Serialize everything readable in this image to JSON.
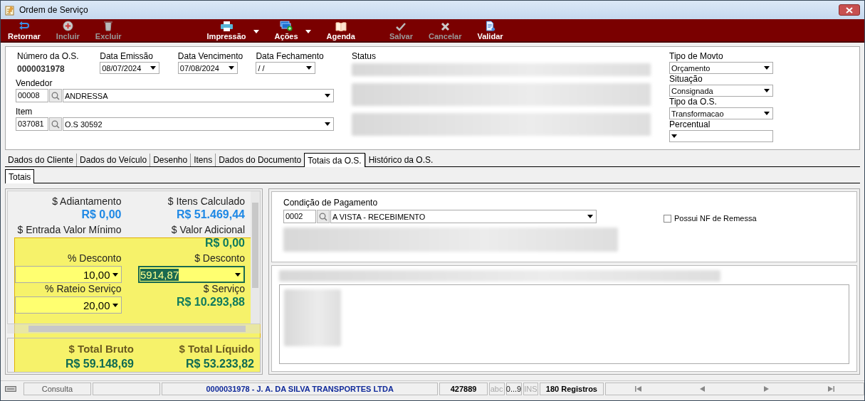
{
  "window": {
    "title": "Ordem de Serviço"
  },
  "toolbar": [
    {
      "label": "Retornar",
      "kind": "return",
      "disabled": false,
      "dropdown": false
    },
    {
      "label": "Incluir",
      "kind": "add",
      "disabled": true,
      "dropdown": false
    },
    {
      "label": "Excluir",
      "kind": "trash",
      "disabled": true,
      "dropdown": false
    },
    {
      "label": "Impressão",
      "kind": "print",
      "disabled": false,
      "dropdown": true
    },
    {
      "label": "Ações",
      "kind": "actions",
      "disabled": false,
      "dropdown": true
    },
    {
      "label": "Agenda",
      "kind": "book",
      "disabled": false,
      "dropdown": false
    },
    {
      "label": "Salvar",
      "kind": "check",
      "disabled": true,
      "dropdown": false
    },
    {
      "label": "Cancelar",
      "kind": "cross",
      "disabled": true,
      "dropdown": false
    },
    {
      "label": "Validar",
      "kind": "document",
      "disabled": false,
      "dropdown": false
    }
  ],
  "header": {
    "os_number": {
      "label": "Número da O.S.",
      "value": "0000031978"
    },
    "dates": [
      {
        "label": "Data Emissão",
        "value": "08/07/2024"
      },
      {
        "label": "Data Vencimento",
        "value": "07/08/2024"
      },
      {
        "label": "Data Fechamento",
        "value": "/ /"
      }
    ],
    "lookups": [
      {
        "label": "Vendedor",
        "code": "00008",
        "value": "ANDRESSA"
      },
      {
        "label": "Item",
        "code": "037081",
        "value": "O.S 30592"
      }
    ],
    "status": {
      "label": "Status"
    },
    "right_fields": [
      {
        "label": "Tipo de Movto",
        "value": "Orçamento"
      },
      {
        "label": "Situação",
        "value": "Consignada"
      },
      {
        "label": "Tipo da O.S.",
        "value": "Transformacao"
      },
      {
        "label": "Percentual"
      }
    ]
  },
  "tabs": [
    {
      "label": "Dados do Cliente",
      "selected": false
    },
    {
      "label": "Dados do Veículo",
      "selected": false
    },
    {
      "label": "Desenho",
      "selected": false
    },
    {
      "label": "Itens",
      "selected": false
    },
    {
      "label": "Dados do Documento",
      "selected": false
    },
    {
      "label": "Totais da O.S.",
      "selected": true
    },
    {
      "label": "Histórico da O.S.",
      "selected": false
    }
  ],
  "subtabs": [
    {
      "label": "Totais",
      "selected": true
    }
  ],
  "totals": {
    "rows": [
      [
        {
          "kind": "amount",
          "label": "$ Adiantamento",
          "value": "R$ 0,00",
          "color": "#1e88e5"
        },
        {
          "kind": "amount",
          "label": "$ Itens Calculado",
          "value": "R$ 51.469,44",
          "color": "#1e88e5"
        }
      ],
      [
        {
          "kind": "label",
          "label": "$ Entrada Valor Mínimo"
        },
        {
          "kind": "amount",
          "label": "$ Valor Adicional",
          "value": "R$ 0,00",
          "color": "#0e7a5e"
        }
      ],
      [
        {
          "kind": "input",
          "label": "% Desconto",
          "value": "10,00",
          "focused": false
        },
        {
          "kind": "input",
          "label": "$ Desconto",
          "value": "5914,87",
          "focused": true
        }
      ],
      [
        {
          "kind": "input",
          "label": "% Rateio Serviço",
          "value": "20,00",
          "focused": false
        },
        {
          "kind": "amount",
          "label": "$ Serviço",
          "value": "R$ 10.293,88",
          "color": "#0e7a5e"
        }
      ]
    ],
    "grand": [
      {
        "label": "$ Total Bruto",
        "value": "R$ 59.148,69"
      },
      {
        "label": "$ Total Líquido",
        "value": "R$ 53.233,82"
      }
    ]
  },
  "payment": {
    "label": "Condição de Pagamento",
    "code": "0002",
    "value": "A VISTA - RECEBIMENTO"
  },
  "remessa": {
    "label": "Possui NF de Remessa",
    "checked": false
  },
  "status_bar": {
    "mode": "Consulta",
    "record": "0000031978 - J. A. DA SILVA TRANSPORTES LTDA",
    "code": "427889",
    "indicators": [
      {
        "label": "abc",
        "on": false
      },
      {
        "label": "0...9",
        "on": true
      },
      {
        "label": "INS",
        "on": false
      }
    ],
    "count": "180 Registros"
  }
}
